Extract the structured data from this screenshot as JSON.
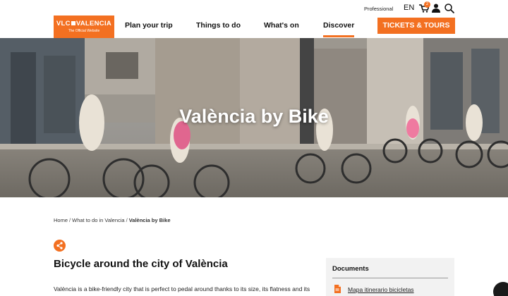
{
  "header": {
    "logo_main": "VLC VALENCIA",
    "logo_left": "VLC",
    "logo_right": "VALENCIA",
    "logo_sub": "The Official Website",
    "nav": [
      "Plan your trip",
      "Things to do",
      "What's on",
      "Discover"
    ],
    "active_nav": "Discover",
    "tickets": "TICKETS & TOURS",
    "professional": "Professional",
    "language": "EN",
    "cart_count": "2",
    "icons": [
      "cart-icon",
      "user-icon",
      "search-icon"
    ]
  },
  "hero": {
    "title": "València by Bike"
  },
  "breadcrumb": {
    "items": [
      "Home",
      "What to do in Valencia",
      "València by Bike"
    ],
    "separator": "/"
  },
  "content": {
    "heading": "Bicycle around the city of València",
    "intro": "València is a bike-friendly city that is perfect to pedal around thanks to its size, its flatness and its"
  },
  "sidebar": {
    "documents_title": "Documents",
    "document_link": "Mapa itinerario bicicletas"
  },
  "colors": {
    "accent": "#f37021",
    "text": "#222222",
    "panel": "#f2f2f2"
  }
}
